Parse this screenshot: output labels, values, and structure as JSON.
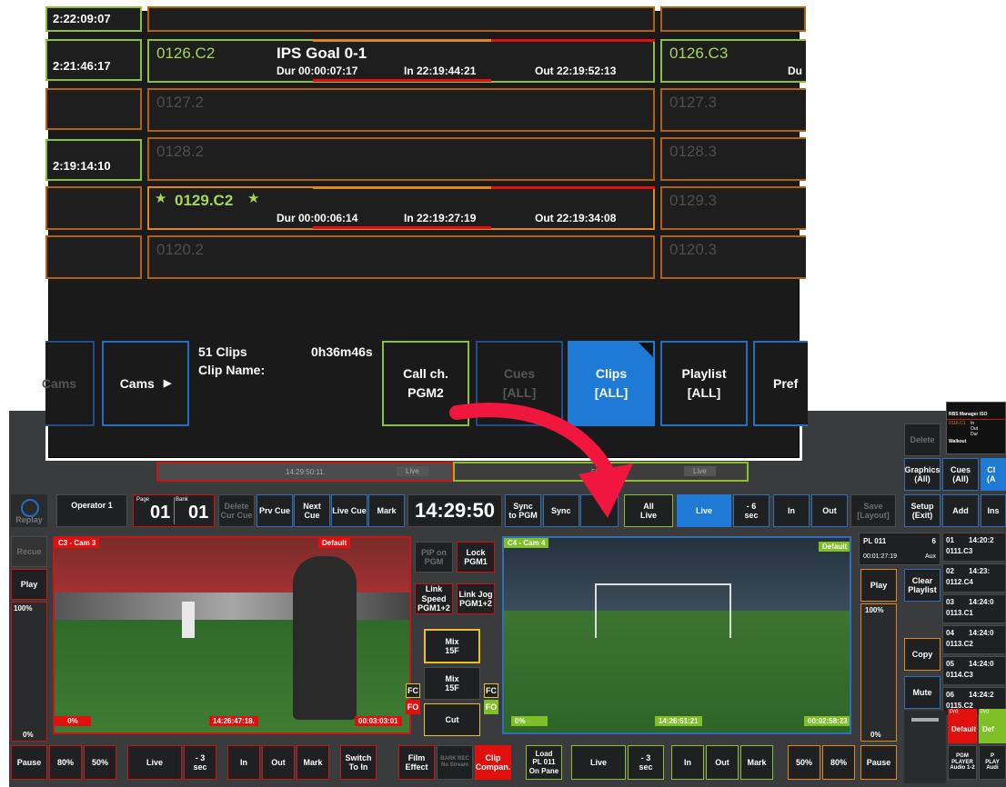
{
  "zoom": {
    "cells": {
      "r0_left_time": "2:22:09:07",
      "r1_left_time": "2:21:46:17",
      "r3_left_time": "2:19:14:10",
      "r1_clip": "0126.C2",
      "r1_title": "IPS Goal 0-1",
      "r1_dur": "Dur 00:00:07:17",
      "r1_in": "In 22:19:44:21",
      "r1_out": "Out 22:19:52:13",
      "r1_right_clip": "0126.C3",
      "r1_right_extra": "Du",
      "r2_clip": "0127.2",
      "r2_right_clip": "0127.3",
      "r3_clip": "0128.2",
      "r3_right_clip": "0128.3",
      "r4_star1": "★",
      "r4_clip": "0129.C2",
      "r4_star2": "★",
      "r4_dur": "Dur 00:00:06:14",
      "r4_in": "In 22:19:27:19",
      "r4_out": "Out 22:19:34:08",
      "r4_right_clip": "0129.3",
      "r5_clip": "0120.2",
      "r5_right_clip": "0120.3"
    },
    "clips_count": "51 Clips",
    "clip_name_label": "Clip Name:",
    "total_time": "0h36m46s",
    "buttons": {
      "cams_partial": "Cams",
      "cams": "Cams",
      "cams_arrow": "▶",
      "call_ch": "Call ch.\nPGM2",
      "cues": "Cues\n[ALL]",
      "clips": "Clips\n[ALL]",
      "playlist": "Playlist\n[ALL]",
      "pref": "Pref"
    }
  },
  "app": {
    "replay": "Replay",
    "operator": "Operator 1",
    "page_label": "Page",
    "page_value": "01",
    "bank_label": "Bank",
    "bank_value": "01",
    "delete_cur_cue": "Delete\nCur Cue",
    "prv_cue": "Prv Cue",
    "next_cue": "Next Cue",
    "live_cue": "Live Cue",
    "mark_top": "Mark",
    "clock": "14:29:50",
    "sync_pgm": "Sync\nto PGM",
    "sync2": "Sync",
    "all_live": "All\nLive",
    "live_top": "Live",
    "minus6": "- 6\nsec",
    "in_top": "In",
    "out_top": "Out",
    "save_layout": "Save\n[Layout]",
    "setup_exit": "Setup\n(Exit)",
    "add": "Add",
    "ins": "Ins",
    "graphics_all": "Graphics\n(All)",
    "cues_all": "Cues\n(All)",
    "cl_partial": "Cl\n(A",
    "delete_right": "Delete",
    "prev_thumb_time1": "14:29:50:11.",
    "prev_thumb_live1": "Live",
    "prev_thumb_time2": "50:12.",
    "prev_thumb_live2": "Live",
    "recue": "Recue",
    "play_left": "Play",
    "pct100_left": "100%",
    "pct0_left": "0%",
    "cam3": "C3 - Cam 3",
    "default_left": "Default",
    "left_pct": "0%",
    "left_tc": "14:26:47:18.",
    "left_dur": "00:03:03:01",
    "pip_on_pgm": "PIP on\nPGM",
    "lock_pgm1": "Lock\nPGM1",
    "link_speed": "Link Speed\nPGM1+2",
    "link_jog": "Link Jog\nPGM1+2",
    "mix15_a": "Mix\n15F",
    "mix15_b": "Mix\n15F",
    "cut": "Cut",
    "fc_left": "FC",
    "fo_left": "FO",
    "fc_right": "FC",
    "fo_right": "FO",
    "cam4": "C4 - Cam 4",
    "default_right": "Default",
    "right_pct": "0%",
    "right_tc": "14:26:51:21",
    "right_dur": "00:02:58:23",
    "pl011": "PL 011",
    "pl_num": "6",
    "pl_time": "00:01:27:19",
    "pl_aux": "Aux",
    "play_right": "Play",
    "pct100_right": "100%",
    "pct0_right": "0%",
    "clear_playlist": "Clear\nPlaylist",
    "copy": "Copy",
    "mute": "Mute",
    "playlist": [
      {
        "num": "01",
        "time": "14:20:2",
        "clip": "0111.C3"
      },
      {
        "num": "02",
        "time": "14:23:",
        "clip": "0112.C4"
      },
      {
        "num": "03",
        "time": "14:24:0",
        "clip": "0113.C1"
      },
      {
        "num": "04",
        "time": "14:24:0",
        "clip": "0113.C2"
      },
      {
        "num": "05",
        "time": "14:24:0",
        "clip": "0114.C3"
      },
      {
        "num": "06",
        "time": "14:24:2",
        "clip": "0115.C2"
      }
    ],
    "mini_r": "RBS Manager ISO",
    "mini_walkout": "Walkout",
    "mini_clip": "0116.C1",
    "mini_in": "In",
    "mini_out": "Out",
    "mini_dur": "Dur",
    "pr0_a": "Pr0",
    "default_red": "Default",
    "pr0_b": "Pr0",
    "def_green": "Def",
    "pgm_player": "PGM\nPLAYER\nAudio 1-2",
    "pgm_player2": "P\nPLAY\nAudi",
    "bottom": {
      "pause": "Pause",
      "p80": "80%",
      "p50": "50%",
      "live": "Live",
      "m3": "- 3\nsec",
      "in": "In",
      "out": "Out",
      "mark": "Mark",
      "switch_to_in": "Switch\nTo In",
      "film_effect": "Film\nEffect",
      "bark_rec": "BARK REC\nNo Stream",
      "clip_compan": "Clip\nCompan.",
      "load_pl": "Load\nPL 011\nOn Pane",
      "live2": "Live",
      "m3b": "- 3\nsec",
      "in2": "In",
      "out2": "Out",
      "mark2": "Mark",
      "p50b": "50%",
      "p80b": "80%",
      "pause2": "Pause"
    }
  },
  "colors": {
    "accent_red": "#e20f0f",
    "accent_green": "#8cc03b",
    "accent_blue": "#1f7ad6",
    "accent_orange": "#e38714"
  }
}
